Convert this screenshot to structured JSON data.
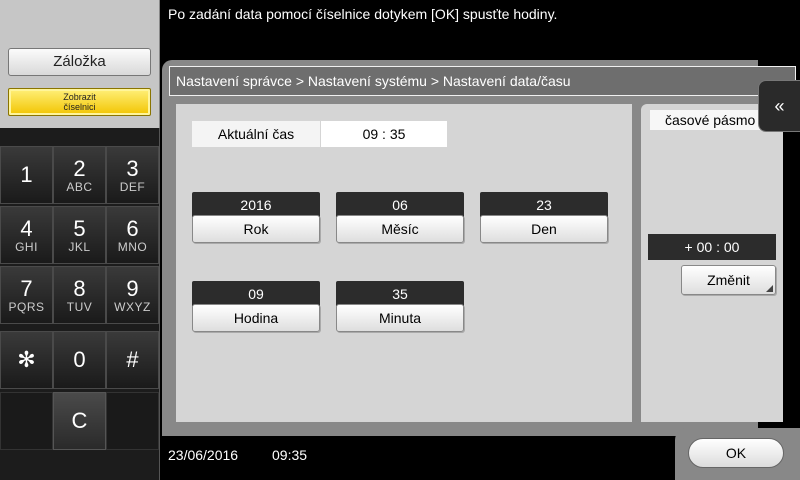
{
  "message": "Po zadání data pomocí číselnice dotykem [OK] spusťte hodiny.",
  "left": {
    "bookmark_label": "Záložka",
    "show_keypad_label": "Zobrazit číselnici"
  },
  "keypad": {
    "keys": [
      {
        "num": "1",
        "letters": ""
      },
      {
        "num": "2",
        "letters": "ABC"
      },
      {
        "num": "3",
        "letters": "DEF"
      },
      {
        "num": "4",
        "letters": "GHI"
      },
      {
        "num": "5",
        "letters": "JKL"
      },
      {
        "num": "6",
        "letters": "MNO"
      },
      {
        "num": "7",
        "letters": "PQRS"
      },
      {
        "num": "8",
        "letters": "TUV"
      },
      {
        "num": "9",
        "letters": "WXYZ"
      },
      {
        "num": "✻",
        "letters": ""
      },
      {
        "num": "0",
        "letters": ""
      },
      {
        "num": "#",
        "letters": ""
      },
      {
        "num": "C",
        "letters": ""
      }
    ]
  },
  "breadcrumb": "Nastavení správce > Nastavení systému > Nastavení data/času",
  "current_time": {
    "label": "Aktuální čas",
    "value": "09  :  35"
  },
  "fields": {
    "year": {
      "value": "2016",
      "label": "Rok"
    },
    "month": {
      "value": "06",
      "label": "Měsíc"
    },
    "day": {
      "value": "23",
      "label": "Den"
    },
    "hour": {
      "value": "09",
      "label": "Hodina"
    },
    "minute": {
      "value": "35",
      "label": "Minuta"
    }
  },
  "timezone": {
    "label": "časové pásmo",
    "value": "+ 00  :  00",
    "change_label": "Změnit"
  },
  "collapse_icon": "«",
  "status": {
    "date": "23/06/2016",
    "time": "09:35"
  },
  "ok_label": "OK"
}
